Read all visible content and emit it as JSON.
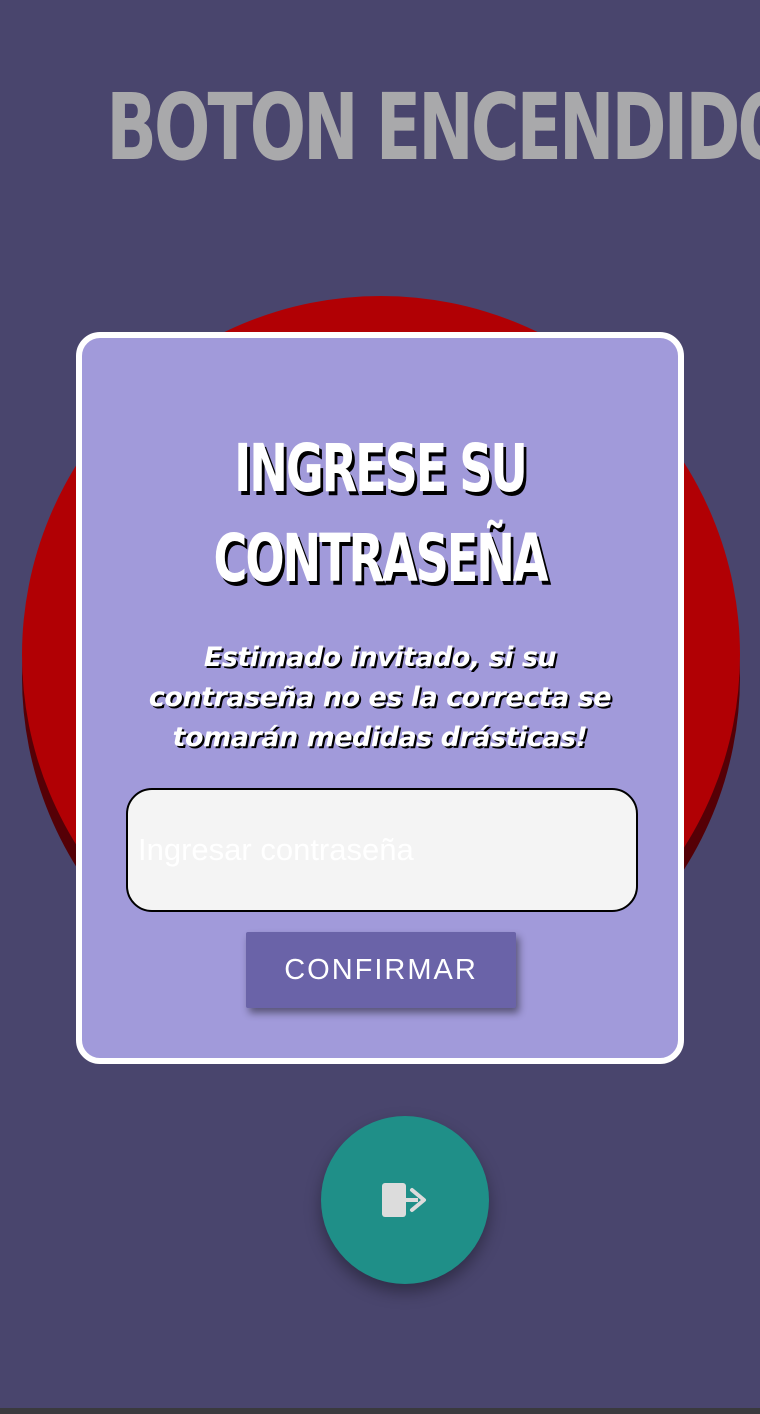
{
  "header": {
    "title": "BOTON ENCENDIDO"
  },
  "power_button": {
    "icon": "red-circle-button"
  },
  "dialog": {
    "title_line1": "INGRESE SU",
    "title_line2": "CONTRASEÑA",
    "message": "Estimado invitado, si su contraseña no es la correcta se tomarán medidas drásticas!",
    "password_placeholder": "Ingresar contraseña",
    "password_value": "",
    "confirm_label": "CONFIRMAR"
  },
  "fab": {
    "icon": "exit-icon"
  },
  "colors": {
    "background": "#49456d",
    "title": "#a9a9ab",
    "red_button": "#b10004",
    "dialog_background": "#a19ada",
    "confirm_button": "#6a63a8",
    "fab": "#1f8f88"
  }
}
